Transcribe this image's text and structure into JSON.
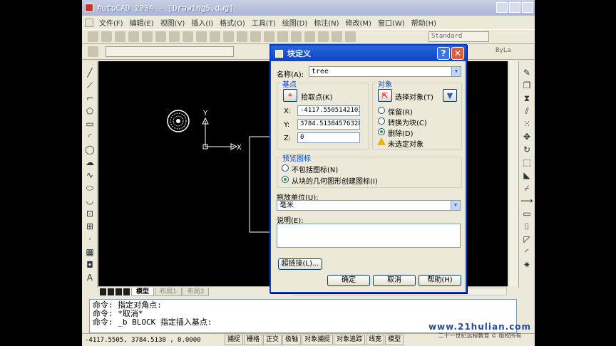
{
  "window": {
    "title": "AutoCAD 2004 - [Drawing5.dwg]"
  },
  "menu": [
    "文件(F)",
    "编辑(E)",
    "视图(V)",
    "插入(I)",
    "格式(O)",
    "工具(T)",
    "绘图(D)",
    "标注(N)",
    "修改(M)",
    "窗口(W)",
    "帮助(H)"
  ],
  "toolbar": {
    "text_style": "Standard",
    "linetype": "ByLa"
  },
  "canvas": {
    "y_label": "Y",
    "x_label": "X"
  },
  "layout_tabs": {
    "model": "模型",
    "layout1": "布局1",
    "layout2": "布局2"
  },
  "command_lines": [
    "命令: 指定对角点:",
    "命令: *取消*",
    "命令: _b BLOCK 指定插入基点:"
  ],
  "status": {
    "coords": "-4117.5505, 3784.5138 , 0.0000",
    "buttons": [
      "捕捉",
      "栅格",
      "正交",
      "极轴",
      "对象捕捉",
      "对象追踪",
      "线宽",
      "模型"
    ]
  },
  "watermark": {
    "line1": "www.21hulian.com",
    "line2": "二十一世纪远程教育 © 版权所有"
  },
  "dialog": {
    "title": "块定义",
    "name_label": "名称(A):",
    "name_value": "tree",
    "base_point": {
      "title": "基点",
      "pick_label": "拾取点(K)",
      "x_label": "X:",
      "x_value": "-4117.55051421032",
      "y_label": "Y:",
      "y_value": "3784.513845763282",
      "z_label": "Z:",
      "z_value": "0"
    },
    "objects": {
      "title": "对象",
      "select_label": "选择对象(T)",
      "retain_label": "保留(R)",
      "convert_label": "转换为块(C)",
      "delete_label": "删除(D)",
      "warning": "未选定对象"
    },
    "preview": {
      "title": "预览图标",
      "no_icon_label": "不包括图标(N)",
      "create_icon_label": "从块的几何图形创建图标(I)"
    },
    "units_label": "拖放单位(U):",
    "units_value": "毫米",
    "desc_label": "说明(E):",
    "hyperlink_btn": "超链接(L)...",
    "ok_btn": "确定",
    "cancel_btn": "取消",
    "help_btn": "帮助(H)"
  },
  "colors": {
    "dialog_title": "#0b45c4",
    "group_title": "#0046d5",
    "canvas": "#000000"
  }
}
